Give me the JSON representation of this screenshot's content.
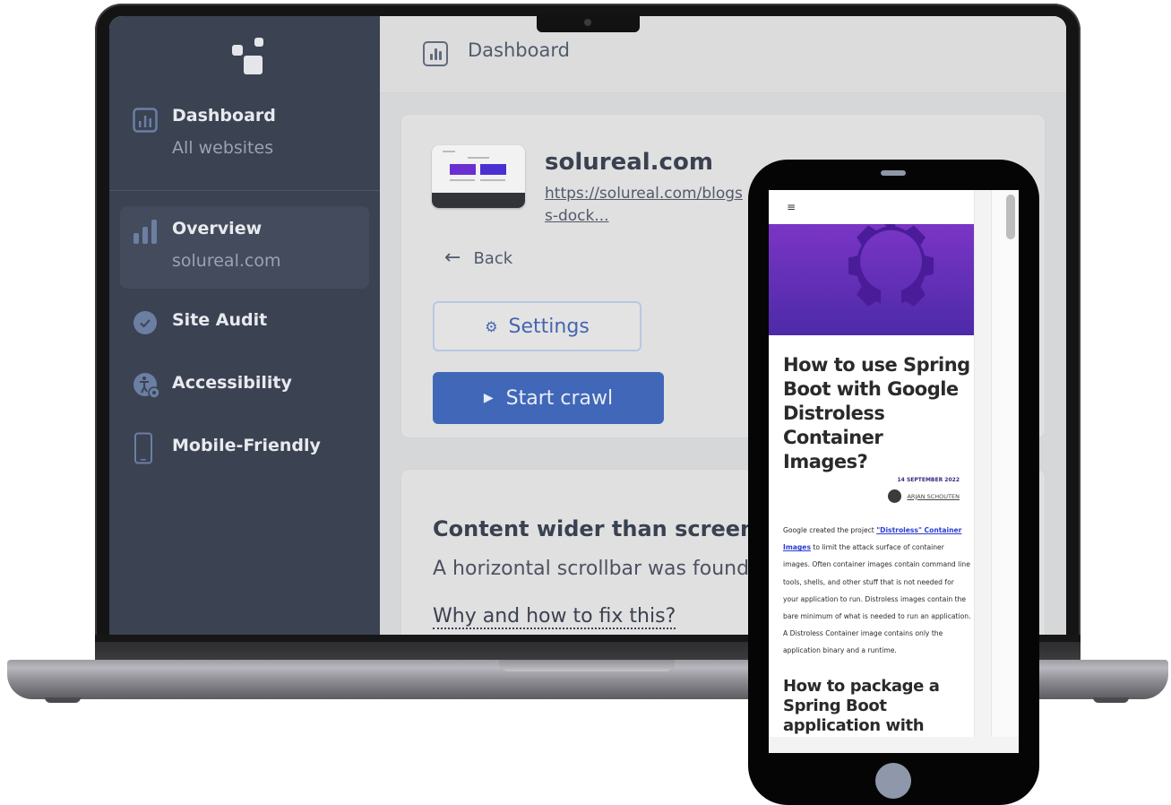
{
  "laptop": {
    "header": {
      "title": "Dashboard",
      "icon": "bar-chart-icon"
    },
    "sidebar": {
      "logo": "squares-logo",
      "items": [
        {
          "title": "Dashboard",
          "subtitle": "All websites",
          "icon": "bar-chart-box-icon",
          "active": false
        },
        {
          "title": "Overview",
          "subtitle": "solureal.com",
          "icon": "signal-bars-icon",
          "active": true
        },
        {
          "title": "Site Audit",
          "icon": "check-badge-icon",
          "active": false
        },
        {
          "title": "Accessibility",
          "icon": "accessibility-gear-icon",
          "active": false
        },
        {
          "title": "Mobile-Friendly",
          "icon": "mobile-phone-icon",
          "active": false
        }
      ]
    },
    "site_card": {
      "name": "solureal.com",
      "url": "https://solureal.com/blogs-dock...",
      "url_line1": "https://solureal.com/blogs",
      "url_line2": "s-dock...",
      "back_label": "Back",
      "back_icon": "←",
      "settings_label": "Settings",
      "settings_icon": "⚙",
      "crawl_label": "Start crawl",
      "crawl_icon": "▶"
    },
    "issue_card": {
      "title": "Content wider than screen",
      "description": "A horizontal scrollbar was found",
      "help_link": "Why and how to fix this?"
    },
    "colors": {
      "sidebar_bg": "#3b4252",
      "primary_button": "#4067b8",
      "outline_button_text": "#4466b0"
    }
  },
  "phone": {
    "menu_icon": "≡",
    "post": {
      "title": "How to use Spring Boot with Google Distroless Container Images?",
      "date": "14 SEPTEMBER 2022",
      "author": "ARJAN SCHOUTEN",
      "body_before_link": "Google created the project ",
      "body_link": "\"Distroless\" Container Images",
      "body_after_link": " to limit the attack surface of container images. Often container images contain command line tools, shells, and other stuff that is not needed for your application to run. Distroless images contain the bare minimum of what is needed to run an application. A Distroless Container image contains only the application binary and a runtime.",
      "subheading": "How to package a Spring Boot application with"
    },
    "colors": {
      "hero_top": "#7a35c5",
      "hero_bottom": "#4d2aa8",
      "link": "#2a3ed0"
    }
  }
}
